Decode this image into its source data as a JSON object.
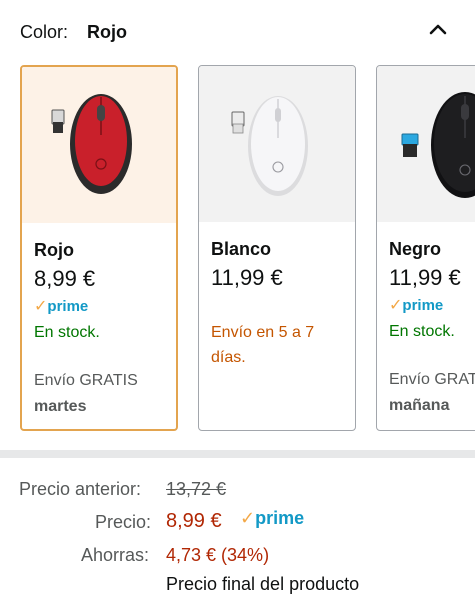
{
  "color_selector": {
    "label": "Color:",
    "selected": "Rojo",
    "collapse_icon": "chevron-up-icon"
  },
  "variants": [
    {
      "name": "Rojo",
      "price": "8,99 €",
      "prime": "prime",
      "availability": "En stock.",
      "shipping": "Envío GRATIS",
      "shipping_day": "martes",
      "selected": true,
      "mouse_color": "#c9202b"
    },
    {
      "name": "Blanco",
      "price": "11,99 €",
      "availability": "Envío en 5 a 7 días.",
      "selected": false,
      "mouse_color": "#f4f4f6"
    },
    {
      "name": "Negro",
      "price": "11,99 €",
      "prime": "prime",
      "availability": "En stock.",
      "shipping": "Envío GRAT",
      "shipping_day": "mañana",
      "selected": false,
      "mouse_color": "#1b1b1d"
    }
  ],
  "pricing": {
    "previous_label": "Precio anterior:",
    "previous_value": "13,72 €",
    "price_label": "Precio:",
    "price_value": "8,99 €",
    "prime": "prime",
    "savings_label": "Ahorras:",
    "savings_value": "4,73 € (34%)",
    "final_note": "Precio final del producto"
  },
  "colors": {
    "selected_border": "#e3a44f",
    "prime_blue": "#1399c6",
    "prime_check": "#f3a847",
    "in_stock_green": "#007600",
    "delivery_orange": "#c45500",
    "price_red": "#b12704"
  }
}
